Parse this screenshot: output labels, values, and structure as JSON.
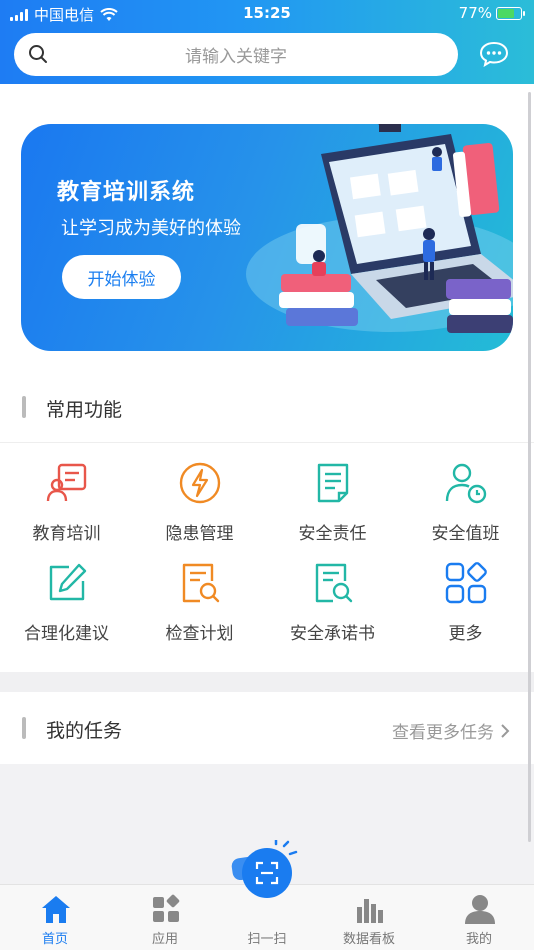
{
  "status": {
    "carrier": "中国电信",
    "time": "15:25",
    "battery": "77%"
  },
  "search": {
    "placeholder": "请输入关键字"
  },
  "banner": {
    "title": "教育培训系统",
    "subtitle": "让学习成为美好的体验",
    "cta": "开始体验"
  },
  "common": {
    "title": "常用功能",
    "items": [
      {
        "label": "教育培训",
        "icon": "training-icon",
        "color": "#e8564a"
      },
      {
        "label": "隐患管理",
        "icon": "lightning-icon",
        "color": "#f08a24"
      },
      {
        "label": "安全责任",
        "icon": "document-icon",
        "color": "#22b7a6"
      },
      {
        "label": "安全值班",
        "icon": "person-clock-icon",
        "color": "#22b7a6"
      },
      {
        "label": "合理化建议",
        "icon": "edit-icon",
        "color": "#22b7a6"
      },
      {
        "label": "检查计划",
        "icon": "doc-search-icon",
        "color": "#f08a24"
      },
      {
        "label": "安全承诺书",
        "icon": "doc-search-icon",
        "color": "#22b7a6"
      },
      {
        "label": "更多",
        "icon": "grid-icon",
        "color": "#1a7cf0"
      }
    ]
  },
  "tasks": {
    "title": "我的任务",
    "more": "查看更多任务"
  },
  "nav": {
    "items": [
      {
        "label": "首页",
        "icon": "home-icon"
      },
      {
        "label": "应用",
        "icon": "apps-icon"
      },
      {
        "label": "扫一扫",
        "icon": "scan-icon"
      },
      {
        "label": "数据看板",
        "icon": "chart-icon"
      },
      {
        "label": "我的",
        "icon": "user-icon"
      }
    ]
  },
  "colors": {
    "accent": "#1a7cf0"
  }
}
